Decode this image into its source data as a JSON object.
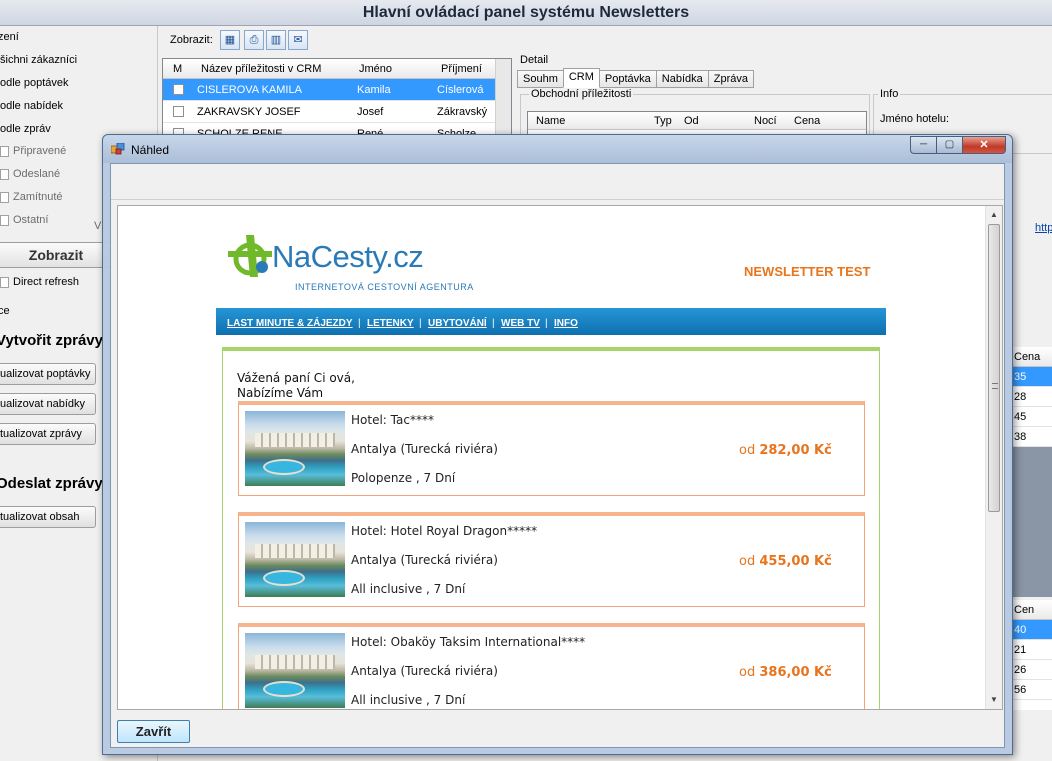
{
  "app": {
    "title": "Hlavní ovládací panel systému Newsletters"
  },
  "left_panel": {
    "section_label": "zení",
    "radios": [
      "šichni zákazníci",
      "odle poptávek",
      "odle nabídek",
      "odle zpráv"
    ],
    "checks": [
      "Připravené",
      "Odeslané",
      "Zamítnuté",
      "Ostatní"
    ],
    "stray_label": "V",
    "show_button": "Zobrazit",
    "direct_refresh": "Direct refresh",
    "actions_label": "ce",
    "create_header": "Vytvořit zprávy",
    "buttons_create": [
      "ualizovat poptávky",
      "ualizovat nabídky",
      "tualizovat zprávy"
    ],
    "send_header": "Odeslat zprávy",
    "buttons_send": [
      "tualizovat obsah"
    ]
  },
  "toolbar": {
    "label": "Zobrazit:",
    "icons": [
      "table-icon",
      "print-icon",
      "layout-icon",
      "mail-icon"
    ]
  },
  "grid": {
    "headers": [
      "M",
      "Název příležitosti v CRM",
      "Jméno",
      "Příjmení"
    ],
    "rows": [
      {
        "name": "CISLEROVA KAMILA",
        "first": "Kamila",
        "last": "Císlerová",
        "selected": true
      },
      {
        "name": "ZAKRAVSKY JOSEF",
        "first": "Josef",
        "last": "Zákravský",
        "selected": false
      },
      {
        "name": "SCHOLZE RENE",
        "first": "René",
        "last": "Scholze",
        "selected": false
      }
    ]
  },
  "detail": {
    "label": "Detail",
    "tabs": [
      "Souhm",
      "CRM",
      "Poptávka",
      "Nabídka",
      "Zpráva"
    ],
    "active_tab": "CRM",
    "group_label": "Obchodní příležitosti",
    "columns": [
      "Name",
      "Typ",
      "Od",
      "Nocí",
      "Cena"
    ],
    "info_label": "Info",
    "hotel_name_label": "Jméno hotelu:",
    "link_fragment": "http"
  },
  "right_strip": {
    "upper_header": "Cena",
    "upper_values": [
      "35",
      "28",
      "45",
      "38"
    ],
    "lower_header": "Cen",
    "lower_values": [
      "40",
      "21",
      "26",
      "56"
    ]
  },
  "dialog": {
    "title": "Náhled",
    "controls": {
      "minimize": "─",
      "maximize": "▢",
      "close": "✕"
    },
    "close_button": "Zavřít"
  },
  "newsletter": {
    "logo_main": "NaCesty",
    "logo_tld": ".cz",
    "logo_sub": "INTERNETOVÁ CESTOVNÍ AGENTURA",
    "test_label": "NEWSLETTER TEST",
    "nav": [
      "LAST MINUTE & ZÁJEZDY",
      "LETENKY",
      "UBYTOVÁNÍ",
      "WEB TV",
      "INFO"
    ],
    "nav_sep": "|",
    "greeting": "Vážená paní Ci      ová,",
    "intro": "Nabízíme Vám",
    "offers": [
      {
        "hotel": "Hotel: Tac****",
        "location": "Antalya (Turecká riviéra)",
        "board": "Polopenze , 7 Dní",
        "price_prefix": "od",
        "price": "282,00 Kč"
      },
      {
        "hotel": "Hotel: Hotel Royal Dragon*****",
        "location": "Antalya (Turecká riviéra)",
        "board": "All inclusive , 7 Dní",
        "price_prefix": "od",
        "price": "455,00 Kč"
      },
      {
        "hotel": "Hotel: Obaköy Taksim International****",
        "location": "Antalya (Turecká riviéra)",
        "board": "All inclusive , 7 Dní",
        "price_prefix": "od",
        "price": "386,00 Kč"
      }
    ]
  },
  "colors": {
    "accent_orange": "#e8741c",
    "nav_blue": "#1a85c6",
    "frame_green": "#a5d46a",
    "selection": "#3399ff"
  }
}
